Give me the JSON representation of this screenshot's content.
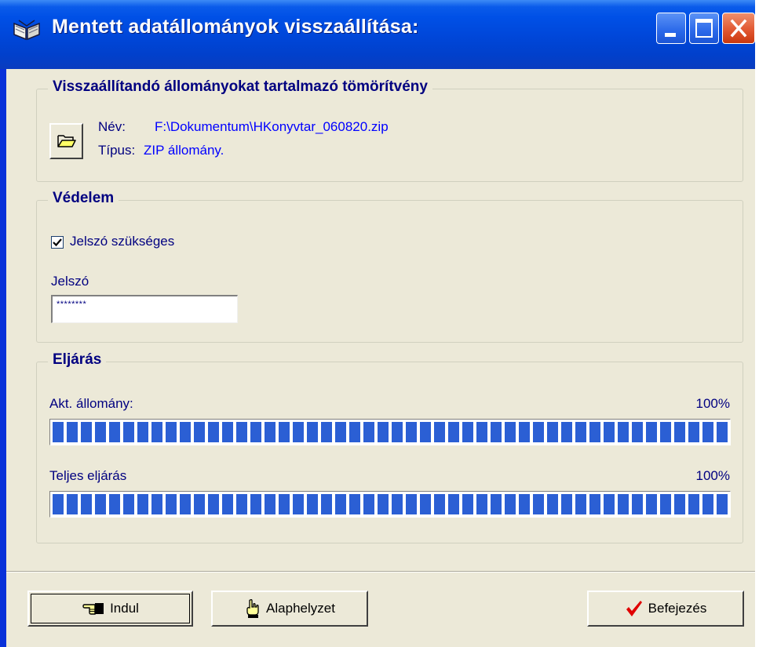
{
  "window": {
    "title": "Mentett adatállományok visszaállítása:",
    "title_bar_color": "#0050e6",
    "controls": [
      "minimize-icon",
      "maximize-icon",
      "close-icon"
    ]
  },
  "archive_group": {
    "title": "Visszaállítandó állományokat tartalmazó tömörítvény",
    "open_button_icon": "folder-open-icon",
    "name_label": "Név:",
    "name_value": "F:\\Dokumentum\\HKonyvtar_060820.zip",
    "type_label": "Típus:",
    "type_value": "ZIP állomány."
  },
  "protection_group": {
    "title": "Védelem",
    "password_required_label": "Jelszó szükséges",
    "password_required_checked": true,
    "password_label": "Jelszó",
    "password_value": "********"
  },
  "process_group": {
    "title": "Eljárás",
    "current_file_label": "Akt. állomány:",
    "current_file_percent_text": "100%",
    "current_file_progress": 1.0,
    "total_label": "Teljes eljárás",
    "total_percent_text": "100%",
    "total_progress": 1.0,
    "bar_color": "#2b5fd4"
  },
  "buttons": {
    "start_label": "Indul",
    "start_icon": "pointing-hand-icon",
    "reset_label": "Alaphelyzet",
    "reset_icon": "hand-up-icon",
    "finish_label": "Befejezés",
    "finish_icon": "red-checkmark-icon"
  }
}
